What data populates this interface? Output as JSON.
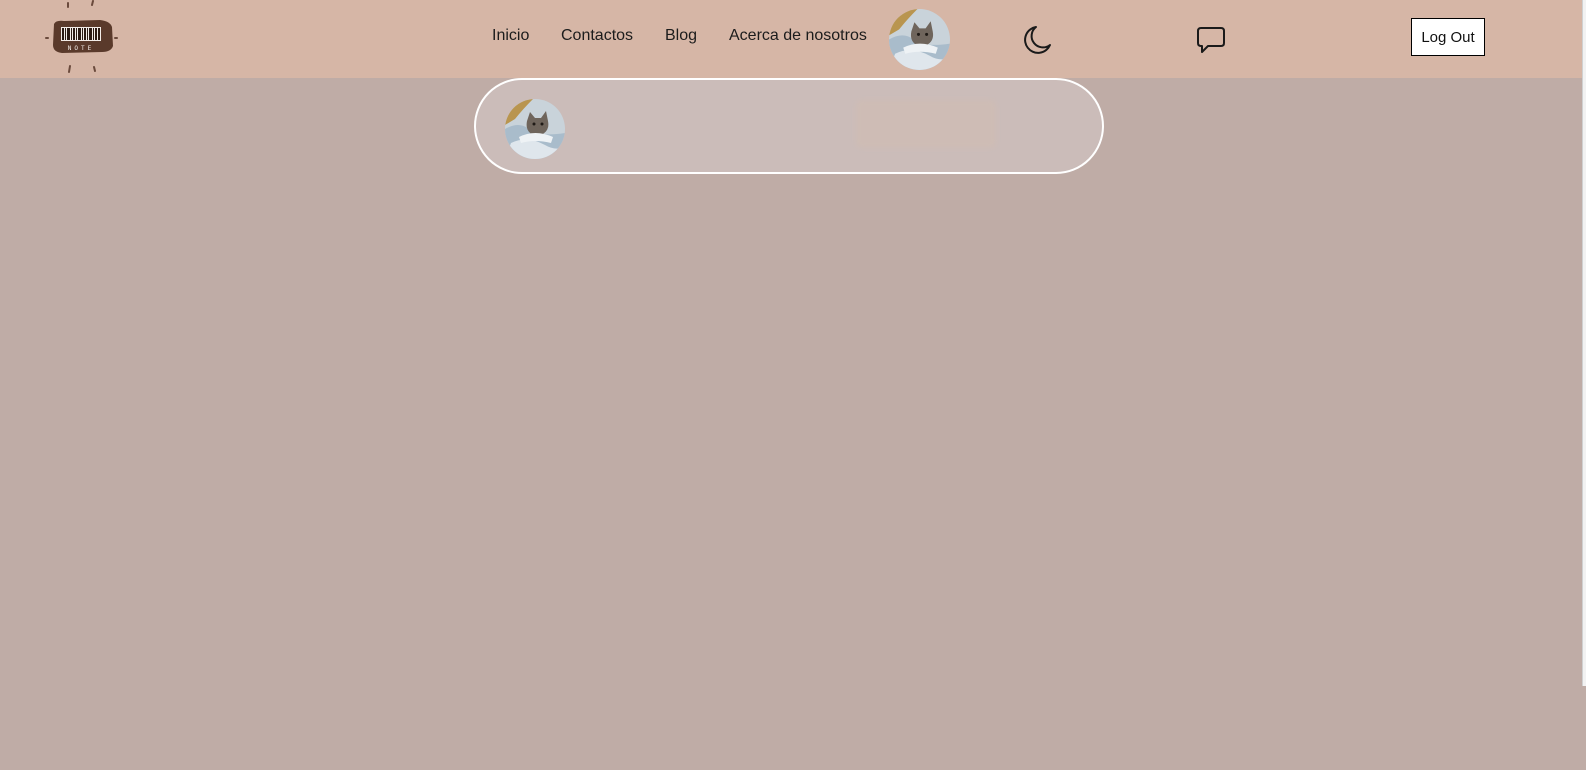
{
  "header": {
    "logo": {
      "icon": "note-barcode-logo-icon",
      "text": "NOTE"
    },
    "nav": [
      {
        "label": "Inicio"
      },
      {
        "label": "Contactos"
      },
      {
        "label": "Blog"
      },
      {
        "label": "Acerca de nosotros"
      }
    ],
    "profile_icon": "cat-avatar-icon",
    "theme_toggle_icon": "moon-icon",
    "messages_icon": "chat-bubble-icon",
    "logout_label": "Log Out"
  },
  "composer": {
    "avatar_icon": "cat-avatar-icon"
  },
  "colors": {
    "header_bg": "#d6b6a6",
    "page_bg": "#bfaca6",
    "card_bg": "#cbbcb9",
    "card_border": "#ffffff"
  }
}
